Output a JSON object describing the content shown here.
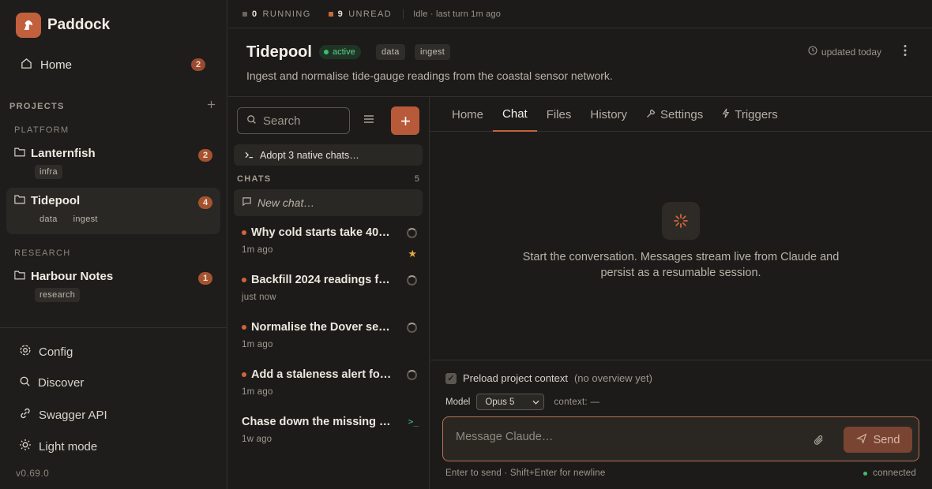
{
  "brand": {
    "name": "Paddock",
    "logo_icon": "horse-icon"
  },
  "sidebar": {
    "home": {
      "label": "Home",
      "badge": "2"
    },
    "projects_heading": "PROJECTS",
    "groups": [
      {
        "label": "PLATFORM"
      },
      {
        "label": "RESEARCH"
      }
    ],
    "projects": [
      {
        "name": "Lanternfish",
        "badge": "2",
        "tags": [
          "infra"
        ]
      },
      {
        "name": "Tidepool",
        "badge": "4",
        "tags": [
          "data",
          "ingest"
        ],
        "selected": true
      },
      {
        "name": "Harbour Notes",
        "badge": "1",
        "tags": [
          "research"
        ]
      }
    ],
    "footer": [
      {
        "label": "Config",
        "icon": "gear-icon"
      },
      {
        "label": "Discover",
        "icon": "search-icon"
      },
      {
        "label": "Swagger API",
        "icon": "link-icon"
      },
      {
        "label": "Light mode",
        "icon": "sun-icon"
      }
    ],
    "version": "v0.69.0"
  },
  "topbar": {
    "running_count": "0",
    "running_label": "RUNNING",
    "unread_count": "9",
    "unread_label": "UNREAD",
    "status": "Idle · last turn 1m ago"
  },
  "project": {
    "title": "Tidepool",
    "status": "active",
    "tags": [
      "data",
      "ingest"
    ],
    "description": "Ingest and normalise tide-gauge readings from the coastal sensor network.",
    "updated": "updated today"
  },
  "chats": {
    "search_placeholder": "Search",
    "pinned": "Adopt 3 native chats…",
    "heading": "CHATS",
    "count": "5",
    "new_chat": "New chat…",
    "items": [
      {
        "title": "Why cold starts take 40…",
        "time": "1m ago",
        "starred": true
      },
      {
        "title": "Backfill 2024 readings f…",
        "time": "just now"
      },
      {
        "title": "Normalise the Dover se…",
        "time": "1m ago"
      },
      {
        "title": "Add a staleness alert fo…",
        "time": "1m ago"
      },
      {
        "title": "Chase down the missing …",
        "time": "1w ago"
      }
    ]
  },
  "tabs": [
    {
      "label": "Home"
    },
    {
      "label": "Chat",
      "active": true
    },
    {
      "label": "Files"
    },
    {
      "label": "History"
    },
    {
      "label": "Settings",
      "icon": "wrench-icon"
    },
    {
      "label": "Triggers",
      "icon": "bolt-icon"
    }
  ],
  "empty_state": {
    "text": "Start the conversation. Messages stream live from Claude and persist as a resumable session."
  },
  "composer": {
    "preload_label": "Preload project context",
    "preload_note": "(no overview yet)",
    "preload_checked": true,
    "model_label": "Model",
    "model_value": "Opus 5",
    "context_label": "context: —",
    "placeholder": "Message Claude…",
    "send_label": "Send",
    "hint": "Enter to send · Shift+Enter for newline",
    "connection": "connected"
  },
  "colors": {
    "accent": "#b85a39",
    "status_green": "#3fbf6e",
    "background": "#1c1b19"
  }
}
